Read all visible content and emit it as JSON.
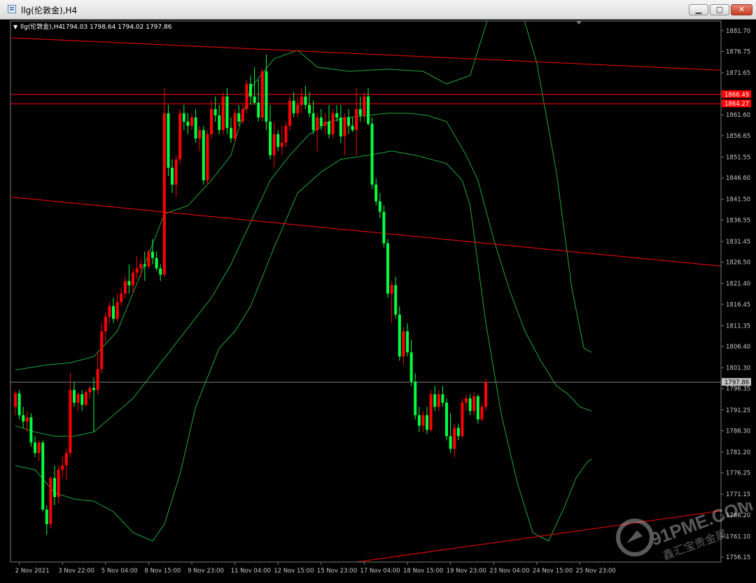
{
  "window": {
    "title": "llg(伦敦金),H4",
    "buttons": {
      "minimize": "▁",
      "maximize": "▢",
      "close": "✕"
    }
  },
  "chart_info": {
    "menu_arrow": "▼",
    "label": "llg(伦敦金),H4",
    "ohlc": "1794.03 1798.64 1794.02 1797.86"
  },
  "watermark": {
    "brand": "91PME.COM",
    "tagline": "鑫汇宝贵金属"
  },
  "colors": {
    "background": "#000000",
    "bull": "#ff0000",
    "bear": "#00ff40",
    "bands": "#1fa83a",
    "trendline": "#ff0000",
    "price_line": "#808080",
    "axis_text": "#c8c8c8"
  },
  "chart_data": {
    "type": "candlestick",
    "symbol": "llg(伦敦金)",
    "timeframe": "H4",
    "ylim": [
      1755.0,
      1884.0
    ],
    "yticks": [
      1881.7,
      1876.75,
      1871.65,
      1866.7,
      1861.6,
      1856.65,
      1851.55,
      1846.6,
      1841.5,
      1836.55,
      1831.45,
      1826.5,
      1821.4,
      1816.45,
      1811.35,
      1806.4,
      1801.3,
      1796.35,
      1791.25,
      1786.3,
      1781.2,
      1776.25,
      1771.15,
      1766.2,
      1761.1,
      1756.15
    ],
    "xticks": [
      {
        "i": 1,
        "label": "2 Nov 2021"
      },
      {
        "i": 12,
        "label": "3 Nov 22:00"
      },
      {
        "i": 23,
        "label": "5 Nov 04:00"
      },
      {
        "i": 34,
        "label": "8 Nov 15:00"
      },
      {
        "i": 45,
        "label": "9 Nov 23:00"
      },
      {
        "i": 56,
        "label": "11 Nov 04:00"
      },
      {
        "i": 67,
        "label": "12 Nov 15:00"
      },
      {
        "i": 78,
        "label": "15 Nov 23:00"
      },
      {
        "i": 89,
        "label": "17 Nov 04:00"
      },
      {
        "i": 100,
        "label": "18 Nov 15:00"
      },
      {
        "i": 111,
        "label": "19 Nov 23:00"
      },
      {
        "i": 122,
        "label": "23 Nov 04:00"
      },
      {
        "i": 133,
        "label": "24 Nov 15:00"
      },
      {
        "i": 144,
        "label": "25 Nov 23:00"
      }
    ],
    "current_price": 1797.86,
    "horizontal_levels": [
      1866.49,
      1864.27
    ],
    "trendlines": [
      {
        "i1": -1,
        "p1": 1880.0,
        "i2": 186,
        "p2": 1872.0
      },
      {
        "i1": -1,
        "p1": 1842.0,
        "i2": 186,
        "p2": 1825.0
      },
      {
        "i1": 87,
        "p1": 1755.0,
        "i2": 186,
        "p2": 1768.0
      }
    ],
    "band_upper": [
      [
        0,
        1800.8
      ],
      [
        8,
        1802.0
      ],
      [
        14,
        1802.5
      ],
      [
        20,
        1804.0
      ],
      [
        26,
        1810.0
      ],
      [
        33,
        1826.0
      ],
      [
        38,
        1838.0
      ],
      [
        44,
        1840.0
      ],
      [
        50,
        1846.0
      ],
      [
        55,
        1852.0
      ],
      [
        60,
        1868.0
      ],
      [
        66,
        1875.0
      ],
      [
        72,
        1877.0
      ],
      [
        77,
        1873.0
      ],
      [
        85,
        1872.0
      ],
      [
        95,
        1872.5
      ],
      [
        104,
        1872.0
      ],
      [
        110,
        1869.0
      ],
      [
        116,
        1871.0
      ],
      [
        120,
        1883.0
      ],
      [
        122,
        1890.0
      ],
      [
        128,
        1890.0
      ],
      [
        133,
        1874.0
      ],
      [
        138,
        1848.0
      ],
      [
        142,
        1820.0
      ],
      [
        145,
        1806.0
      ],
      [
        147,
        1805.0
      ]
    ],
    "band_middle": [
      [
        0,
        1787.5
      ],
      [
        5,
        1786.0
      ],
      [
        10,
        1785.0
      ],
      [
        15,
        1785.0
      ],
      [
        20,
        1786.0
      ],
      [
        25,
        1790.0
      ],
      [
        30,
        1794.0
      ],
      [
        35,
        1800.0
      ],
      [
        40,
        1806.0
      ],
      [
        45,
        1812.0
      ],
      [
        50,
        1818.0
      ],
      [
        55,
        1826.0
      ],
      [
        60,
        1836.0
      ],
      [
        65,
        1846.0
      ],
      [
        70,
        1852.0
      ],
      [
        75,
        1857.0
      ],
      [
        80,
        1860.0
      ],
      [
        85,
        1861.0
      ],
      [
        90,
        1861.5
      ],
      [
        95,
        1862.0
      ],
      [
        100,
        1862.0
      ],
      [
        105,
        1861.5
      ],
      [
        110,
        1860.0
      ],
      [
        115,
        1852.0
      ],
      [
        118,
        1846.0
      ],
      [
        122,
        1832.0
      ],
      [
        126,
        1820.0
      ],
      [
        130,
        1810.0
      ],
      [
        134,
        1803.0
      ],
      [
        138,
        1797.0
      ],
      [
        141,
        1795.0
      ],
      [
        144,
        1792.0
      ],
      [
        147,
        1791.0
      ]
    ],
    "band_lower": [
      [
        0,
        1778.0
      ],
      [
        5,
        1777.0
      ],
      [
        10,
        1771.5
      ],
      [
        15,
        1770.0
      ],
      [
        20,
        1769.5
      ],
      [
        25,
        1767.0
      ],
      [
        30,
        1762.0
      ],
      [
        35,
        1760.0
      ],
      [
        38,
        1764.0
      ],
      [
        42,
        1776.0
      ],
      [
        46,
        1792.0
      ],
      [
        52,
        1806.0
      ],
      [
        56,
        1810.0
      ],
      [
        60,
        1816.0
      ],
      [
        66,
        1830.0
      ],
      [
        72,
        1843.0
      ],
      [
        78,
        1848.0
      ],
      [
        83,
        1851.0
      ],
      [
        90,
        1852.0
      ],
      [
        96,
        1853.0
      ],
      [
        102,
        1852.0
      ],
      [
        106,
        1851.0
      ],
      [
        110,
        1850.0
      ],
      [
        114,
        1846.0
      ],
      [
        116,
        1840.0
      ],
      [
        120,
        1812.0
      ],
      [
        124,
        1790.0
      ],
      [
        128,
        1774.0
      ],
      [
        132,
        1762.0
      ],
      [
        136,
        1760.0
      ],
      [
        140,
        1768.0
      ],
      [
        143,
        1775.0
      ],
      [
        146,
        1779.0
      ],
      [
        147,
        1779.5
      ]
    ],
    "candles": [
      [
        1792.0,
        1795.8,
        1790.0,
        1795.2
      ],
      [
        1795.2,
        1796.0,
        1789.0,
        1790.0
      ],
      [
        1790.0,
        1792.0,
        1787.0,
        1788.5
      ],
      [
        1788.5,
        1791.0,
        1786.0,
        1789.5
      ],
      [
        1789.5,
        1790.5,
        1782.5,
        1783.5
      ],
      [
        1783.5,
        1785.0,
        1780.0,
        1781.0
      ],
      [
        1781.0,
        1784.0,
        1779.0,
        1783.5
      ],
      [
        1783.5,
        1784.0,
        1767.0,
        1767.5
      ],
      [
        1767.5,
        1768.5,
        1761.5,
        1764.0
      ],
      [
        1764.0,
        1775.5,
        1763.0,
        1775.0
      ],
      [
        1775.0,
        1778.0,
        1768.5,
        1770.5
      ],
      [
        1770.5,
        1778.0,
        1769.0,
        1777.0
      ],
      [
        1777.0,
        1780.0,
        1775.0,
        1778.0
      ],
      [
        1778.0,
        1782.0,
        1774.5,
        1781.0
      ],
      [
        1781.0,
        1800.0,
        1780.0,
        1796.0
      ],
      [
        1796.0,
        1798.0,
        1792.0,
        1793.0
      ],
      [
        1793.0,
        1795.5,
        1791.0,
        1795.0
      ],
      [
        1795.0,
        1796.0,
        1791.0,
        1792.5
      ],
      [
        1792.5,
        1796.0,
        1792.0,
        1795.5
      ],
      [
        1795.5,
        1797.0,
        1794.0,
        1796.5
      ],
      [
        1796.5,
        1799.0,
        1786.0,
        1796.0
      ],
      [
        1796.0,
        1805.0,
        1795.0,
        1801.0
      ],
      [
        1801.0,
        1812.0,
        1800.0,
        1810.0
      ],
      [
        1810.0,
        1814.5,
        1807.5,
        1813.5
      ],
      [
        1813.5,
        1817.0,
        1812.0,
        1816.0
      ],
      [
        1816.0,
        1818.0,
        1812.0,
        1813.0
      ],
      [
        1813.0,
        1819.0,
        1812.5,
        1817.0
      ],
      [
        1817.0,
        1820.5,
        1816.0,
        1819.0
      ],
      [
        1819.0,
        1823.0,
        1818.0,
        1822.0
      ],
      [
        1822.0,
        1826.0,
        1819.0,
        1821.0
      ],
      [
        1821.0,
        1825.0,
        1819.0,
        1824.0
      ],
      [
        1824.0,
        1828.0,
        1822.5,
        1825.0
      ],
      [
        1825.0,
        1827.0,
        1823.0,
        1826.0
      ],
      [
        1826.0,
        1829.0,
        1822.0,
        1825.5
      ],
      [
        1825.5,
        1829.5,
        1825.0,
        1829.0
      ],
      [
        1829.0,
        1832.0,
        1826.0,
        1827.5
      ],
      [
        1827.5,
        1829.0,
        1824.5,
        1825.0
      ],
      [
        1825.0,
        1826.0,
        1822.0,
        1823.5
      ],
      [
        1823.5,
        1868.0,
        1823.0,
        1862.0
      ],
      [
        1862.0,
        1864.0,
        1847.0,
        1849.0
      ],
      [
        1849.0,
        1851.0,
        1843.0,
        1845.0
      ],
      [
        1845.0,
        1852.0,
        1842.0,
        1851.0
      ],
      [
        1851.0,
        1863.0,
        1850.0,
        1862.0
      ],
      [
        1862.0,
        1864.0,
        1858.0,
        1860.0
      ],
      [
        1860.0,
        1862.0,
        1857.0,
        1859.0
      ],
      [
        1859.0,
        1862.0,
        1858.0,
        1861.0
      ],
      [
        1861.0,
        1863.0,
        1855.0,
        1856.0
      ],
      [
        1856.0,
        1859.0,
        1853.0,
        1858.0
      ],
      [
        1858.0,
        1859.0,
        1845.0,
        1846.0
      ],
      [
        1846.0,
        1858.0,
        1845.0,
        1857.0
      ],
      [
        1857.0,
        1865.0,
        1856.0,
        1863.0
      ],
      [
        1863.0,
        1866.0,
        1860.0,
        1861.5
      ],
      [
        1861.5,
        1864.0,
        1857.0,
        1858.0
      ],
      [
        1858.0,
        1867.0,
        1857.0,
        1866.0
      ],
      [
        1866.0,
        1868.0,
        1857.0,
        1858.5
      ],
      [
        1858.5,
        1861.0,
        1855.0,
        1856.0
      ],
      [
        1856.0,
        1863.0,
        1855.0,
        1862.0
      ],
      [
        1862.0,
        1864.0,
        1859.0,
        1860.0
      ],
      [
        1860.0,
        1864.0,
        1859.5,
        1863.0
      ],
      [
        1863.0,
        1870.0,
        1862.0,
        1869.0
      ],
      [
        1869.0,
        1871.0,
        1864.0,
        1866.0
      ],
      [
        1866.0,
        1873.0,
        1864.0,
        1864.5
      ],
      [
        1864.5,
        1870.0,
        1860.0,
        1861.0
      ],
      [
        1861.0,
        1872.5,
        1860.0,
        1872.0
      ],
      [
        1872.0,
        1876.0,
        1858.0,
        1860.0
      ],
      [
        1860.0,
        1864.0,
        1851.0,
        1852.0
      ],
      [
        1852.0,
        1860.0,
        1849.0,
        1857.0
      ],
      [
        1857.0,
        1858.0,
        1853.0,
        1854.0
      ],
      [
        1854.0,
        1859.0,
        1852.0,
        1855.0
      ],
      [
        1855.0,
        1860.0,
        1854.0,
        1859.0
      ],
      [
        1859.0,
        1866.0,
        1858.0,
        1865.0
      ],
      [
        1865.0,
        1867.0,
        1861.0,
        1862.0
      ],
      [
        1862.0,
        1866.0,
        1861.0,
        1864.0
      ],
      [
        1864.0,
        1868.0,
        1862.0,
        1866.0
      ],
      [
        1866.0,
        1868.5,
        1863.0,
        1864.0
      ],
      [
        1864.0,
        1867.0,
        1861.0,
        1862.0
      ],
      [
        1862.0,
        1865.0,
        1857.0,
        1858.0
      ],
      [
        1858.0,
        1862.0,
        1853.0,
        1861.0
      ],
      [
        1861.0,
        1863.0,
        1858.0,
        1859.0
      ],
      [
        1859.0,
        1862.0,
        1857.0,
        1860.0
      ],
      [
        1860.0,
        1864.0,
        1856.0,
        1857.0
      ],
      [
        1857.0,
        1863.0,
        1856.0,
        1862.0
      ],
      [
        1862.0,
        1864.0,
        1860.0,
        1861.0
      ],
      [
        1861.0,
        1864.0,
        1855.0,
        1856.5
      ],
      [
        1856.5,
        1862.0,
        1852.0,
        1861.0
      ],
      [
        1861.0,
        1863.0,
        1857.0,
        1859.0
      ],
      [
        1859.0,
        1861.0,
        1857.5,
        1858.0
      ],
      [
        1858.0,
        1868.0,
        1852.0,
        1863.0
      ],
      [
        1863.0,
        1866.0,
        1860.0,
        1861.5
      ],
      [
        1861.5,
        1867.0,
        1860.0,
        1866.0
      ],
      [
        1866.0,
        1868.0,
        1859.0,
        1859.5
      ],
      [
        1859.5,
        1861.0,
        1844.0,
        1845.0
      ],
      [
        1845.0,
        1846.5,
        1840.0,
        1841.0
      ],
      [
        1841.0,
        1843.0,
        1837.0,
        1838.5
      ],
      [
        1838.5,
        1840.0,
        1830.0,
        1831.0
      ],
      [
        1831.0,
        1832.0,
        1818.0,
        1819.0
      ],
      [
        1819.0,
        1822.0,
        1812.0,
        1821.0
      ],
      [
        1821.0,
        1823.0,
        1813.0,
        1814.0
      ],
      [
        1814.0,
        1816.0,
        1803.0,
        1804.0
      ],
      [
        1804.0,
        1811.0,
        1802.0,
        1810.0
      ],
      [
        1810.0,
        1812.0,
        1804.0,
        1805.0
      ],
      [
        1805.0,
        1808.0,
        1797.0,
        1798.0
      ],
      [
        1798.0,
        1800.0,
        1789.0,
        1790.0
      ],
      [
        1790.0,
        1792.0,
        1786.0,
        1787.5
      ],
      [
        1787.5,
        1791.0,
        1786.0,
        1790.0
      ],
      [
        1790.0,
        1792.0,
        1785.5,
        1786.5
      ],
      [
        1786.5,
        1796.0,
        1786.0,
        1795.0
      ],
      [
        1795.0,
        1797.0,
        1791.0,
        1792.0
      ],
      [
        1792.0,
        1796.0,
        1791.0,
        1795.0
      ],
      [
        1795.0,
        1797.0,
        1792.0,
        1793.0
      ],
      [
        1793.0,
        1794.0,
        1784.0,
        1785.0
      ],
      [
        1785.0,
        1790.5,
        1781.0,
        1782.0
      ],
      [
        1782.0,
        1788.0,
        1780.0,
        1787.0
      ],
      [
        1787.0,
        1788.0,
        1784.0,
        1785.0
      ],
      [
        1785.0,
        1794.0,
        1784.5,
        1793.0
      ],
      [
        1793.0,
        1795.0,
        1791.0,
        1794.0
      ],
      [
        1794.0,
        1795.0,
        1790.0,
        1791.0
      ],
      [
        1791.0,
        1795.5,
        1790.0,
        1794.5
      ],
      [
        1794.5,
        1795.0,
        1788.0,
        1789.0
      ],
      [
        1789.0,
        1793.0,
        1788.5,
        1792.0
      ],
      [
        1792.0,
        1798.64,
        1791.0,
        1797.86
      ]
    ]
  }
}
